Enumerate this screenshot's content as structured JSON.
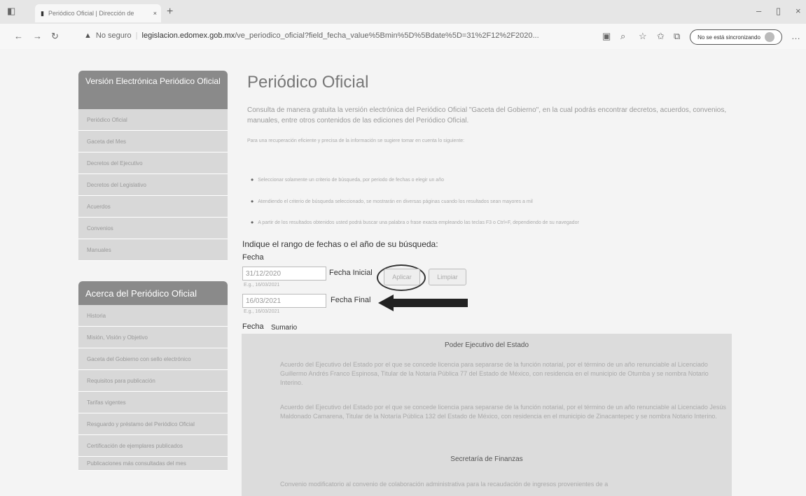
{
  "browser": {
    "tab_title": "Periódico Oficial | Dirección de",
    "not_secure": "No seguro",
    "url_domain": "legislacion.edomex.gob.mx",
    "url_path": "/ve_periodico_oficial?field_fecha_value%5Bmin%5D%5Bdate%5D=31%2F12%2F2020...",
    "sync_label": "No se está sincronizando"
  },
  "sidebar": {
    "section1_title": "Versión Electrónica Periódico Oficial",
    "section1_items": [
      "Periódico Oficial",
      "Gaceta del Mes",
      "Decretos del Ejecutivo",
      "Decretos del Legislativo",
      "Acuerdos",
      "Convenios",
      "Manuales"
    ],
    "section2_title": "Acerca del Periódico Oficial",
    "section2_items": [
      "Historia",
      "Misión, Visión y Objetivo",
      "Gaceta del Gobierno con sello electrónico",
      "Requisitos para publicación",
      "Tarifas vigentes",
      "Resguardo y préstamo del Periódico Oficial",
      "Certificación de ejemplares publicados",
      "Publicaciones más consultadas del mes"
    ]
  },
  "main": {
    "title": "Periódico Oficial",
    "intro": "Consulta de manera gratuita la versión electrónica del Periódico Oficial \"Gaceta del Gobierno\", en la cual podrás encontrar decretos, acuerdos, convenios, manuales, entre otros contenidos de las ediciones del Periódico Oficial.",
    "tip": "Para una recuperación eficiente y precisa de la información se sugiere tomar en cuenta lo siguiente:",
    "bullets": [
      "Seleccionar solamente un criterio de búsqueda, por periodo de fechas o elegir un año",
      "Atendiendo el criterio de búsqueda seleccionado, se mostrarán en diversas páginas cuando los resultados sean mayores a mil",
      "A partir de los resultados obtenidos usted podrá buscar una palabra o frase exacta empleando las teclas F3 o Ctrl+F, dependiendo de su navegador"
    ],
    "range_prompt": "Indique el rango de fechas o el año de su búsqueda:",
    "fecha_label": "Fecha",
    "fecha_inicial_value": "31/12/2020",
    "fecha_inicial_label": "Fecha Inicial",
    "fecha_inicial_example": "E.g., 16/03/2021",
    "fecha_final_value": "16/03/2021",
    "fecha_final_label": "Fecha Final",
    "fecha_final_example": "E.g., 16/03/2021",
    "apply_button": "Aplicar",
    "clear_button": "Limpiar",
    "col_fecha": "Fecha",
    "col_sumario": "Sumario",
    "section_poder": "Poder Ejecutivo del Estado",
    "para1": "Acuerdo del Ejecutivo del Estado por el que se concede licencia para separarse de la función notarial, por el término de un año renunciable al Licenciado Guillermo Andrés Franco Espinosa, Titular de la Notaría Pública 77 del Estado de México, con residencia en el municipio de Otumba y se nombra Notario Interino.",
    "para2": "Acuerdo del Ejecutivo del Estado por el que se concede licencia para separarse de la función notarial, por el término de un año renunciable al Licenciado Jesús Maldonado Camarena, Titular de la Notaría Pública 132 del Estado de México, con residencia en el municipio de Zinacantepec y se nombra Notario Interino.",
    "section_finanzas": "Secretaría de Finanzas",
    "para3": "Convenio modificatorio al convenio de colaboración administrativa para la recaudación de ingresos provenientes de a"
  }
}
